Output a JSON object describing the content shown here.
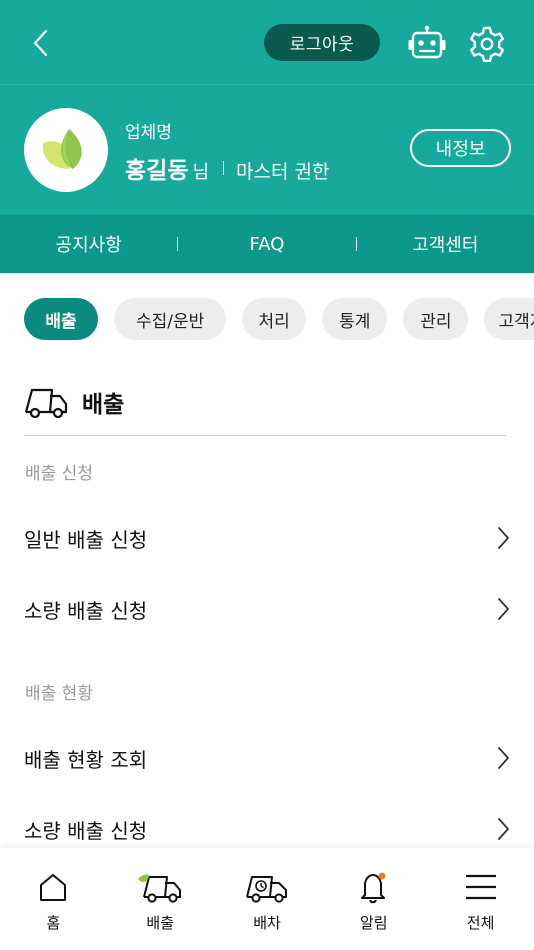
{
  "header": {
    "logout_label": "로그아웃"
  },
  "profile": {
    "company": "업체명",
    "name": "홍길동",
    "suffix": "님",
    "role": "마스터 권한",
    "myinfo_label": "내정보"
  },
  "subnav": {
    "items": [
      "공지사항",
      "FAQ",
      "고객센터"
    ]
  },
  "chips": [
    {
      "label": "배출",
      "active": true
    },
    {
      "label": "수집/운반",
      "active": false
    },
    {
      "label": "처리",
      "active": false
    },
    {
      "label": "통계",
      "active": false
    },
    {
      "label": "관리",
      "active": false
    },
    {
      "label": "고객지원",
      "active": false
    }
  ],
  "section": {
    "title": "배출"
  },
  "groups": [
    {
      "label": "배출 신청",
      "items": [
        "일반 배출 신청",
        "소량 배출 신청"
      ]
    },
    {
      "label": "배출 현황",
      "items": [
        "배출 현황 조회",
        "소량 배출 신청"
      ]
    }
  ],
  "bottom_nav": [
    {
      "label": "홈",
      "icon": "home-icon"
    },
    {
      "label": "배출",
      "icon": "truck-leaf-icon"
    },
    {
      "label": "배차",
      "icon": "truck-dispatch-icon"
    },
    {
      "label": "알림",
      "icon": "bell-icon"
    },
    {
      "label": "전체",
      "icon": "menu-icon"
    }
  ],
  "colors": {
    "primary": "#16a99c",
    "primary_dark": "#0c988b",
    "chip_active": "#0b8a7e",
    "logout_bg": "#0b5a4f",
    "leaf": "#8fc54b",
    "notification_dot": "#f07d1a"
  }
}
